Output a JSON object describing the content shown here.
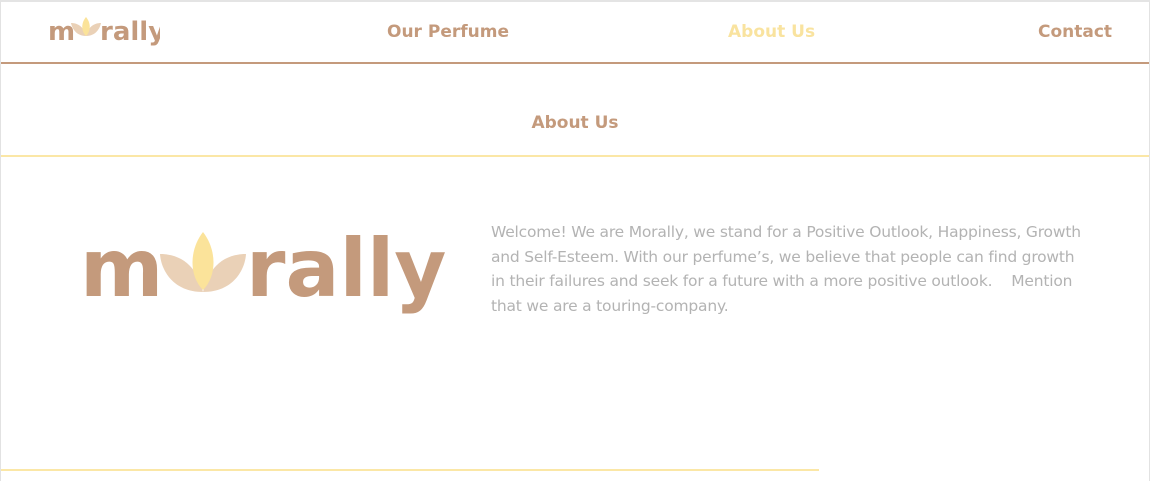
{
  "brand": {
    "name": "morally",
    "letters_left": "m",
    "letters_right": "rally",
    "colors": {
      "brown": "#c49a7c",
      "petal_light": "#ead1b7",
      "petal_yellow": "#fbe39a"
    }
  },
  "nav": {
    "items": [
      {
        "label": "Our Perfume",
        "active": false
      },
      {
        "label": "About Us",
        "active": true
      },
      {
        "label": "Contact",
        "active": false
      }
    ],
    "colors": {
      "link": "#c49a7c",
      "active": "#f9e39f",
      "border": "#c49a7c"
    }
  },
  "about": {
    "title": "About Us",
    "body": "Welcome! We are Morally, we stand for a Positive Outlook, Happiness, Growth and Self-Esteem. With our perfume’s, we believe that people can find growth in their failures and seek for a future with a more positive outlook.    Mention that we are a touring-company."
  },
  "colors": {
    "divider_yellow": "#fbe7a6",
    "body_text": "#b3b3b3"
  }
}
